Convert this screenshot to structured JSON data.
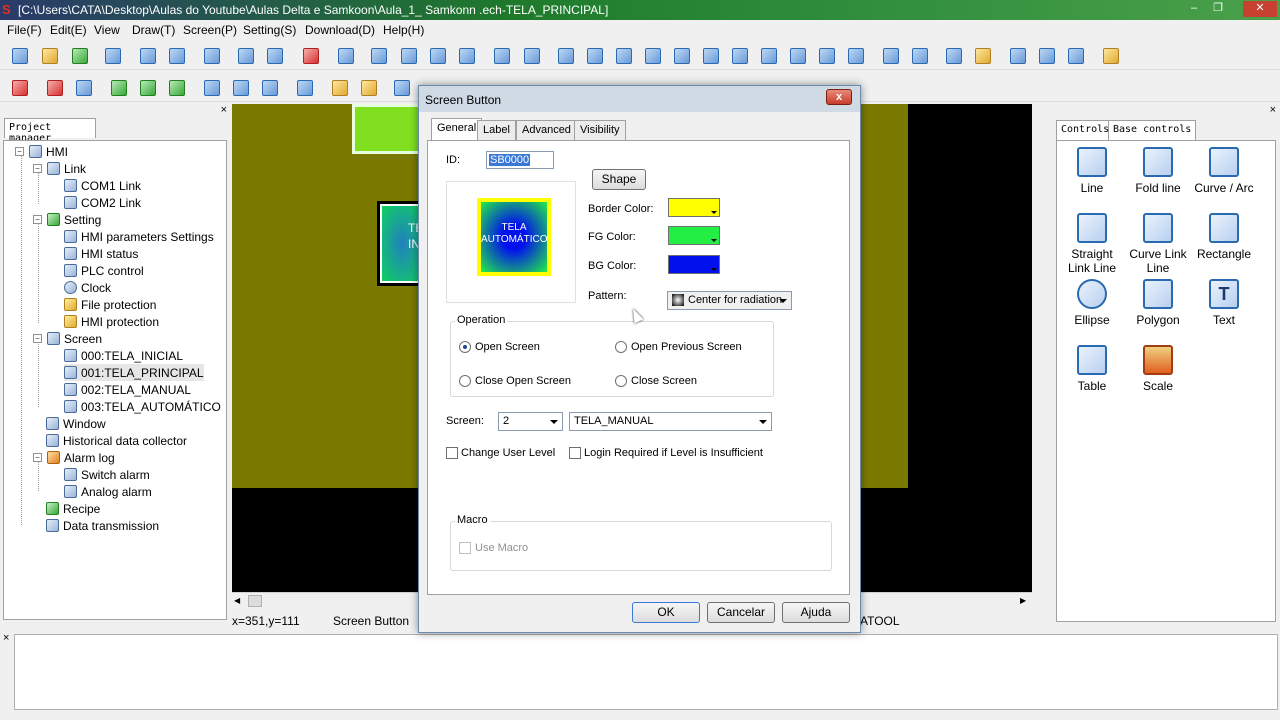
{
  "window": {
    "title": "[C:\\Users\\CATA\\Desktop\\Aulas do Youtube\\Aulas Delta e Samkoon\\Aula_1_ Samkonn .ech-TELA_PRINCIPAL]",
    "min": "–",
    "max": "❐",
    "close": "✕"
  },
  "menu": [
    "File(F)",
    "Edit(E)",
    "View",
    "Draw(T)",
    "Screen(P)",
    "Setting(S)",
    "Download(D)",
    "Help(H)"
  ],
  "project_manager": {
    "tab": "Project manager",
    "close": "×",
    "tree": [
      {
        "label": "HMI",
        "depth": 0
      },
      {
        "label": "Link",
        "depth": 1
      },
      {
        "label": "COM1 Link",
        "depth": 2
      },
      {
        "label": "COM2 Link",
        "depth": 2
      },
      {
        "label": "Setting",
        "depth": 1
      },
      {
        "label": "HMI parameters Settings",
        "depth": 2
      },
      {
        "label": "HMI status",
        "depth": 2
      },
      {
        "label": "PLC control",
        "depth": 2
      },
      {
        "label": "Clock",
        "depth": 2
      },
      {
        "label": "File protection",
        "depth": 2
      },
      {
        "label": "HMI protection",
        "depth": 2
      },
      {
        "label": "Screen",
        "depth": 1
      },
      {
        "label": "000:TELA_INICIAL",
        "depth": 2
      },
      {
        "label": "001:TELA_PRINCIPAL",
        "depth": 2
      },
      {
        "label": "002:TELA_MANUAL",
        "depth": 2
      },
      {
        "label": "003:TELA_AUTOMÁTICO",
        "depth": 2
      },
      {
        "label": "Window",
        "depth": 1
      },
      {
        "label": "Historical data collector",
        "depth": 1
      },
      {
        "label": "Alarm log",
        "depth": 1
      },
      {
        "label": "Switch alarm",
        "depth": 2
      },
      {
        "label": "Analog alarm",
        "depth": 2
      },
      {
        "label": "Recipe",
        "depth": 1
      },
      {
        "label": "Data transmission",
        "depth": 1
      }
    ]
  },
  "canvas": {
    "partial_button_text": "TE\nIN"
  },
  "status": {
    "coords": "x=351,y=111",
    "object": "Screen Button",
    "right": "ATOOL"
  },
  "controls_panel": {
    "tabs": [
      "Controls",
      "Base controls"
    ],
    "close": "×",
    "items": [
      "Line",
      "Fold line",
      "Curve / Arc",
      "Straight Link Line",
      "Curve Link Line",
      "Rectangle",
      "Ellipse",
      "Polygon",
      "Text",
      "Table",
      "Scale"
    ]
  },
  "dialog": {
    "title": "Screen Button",
    "close": "x",
    "tabs": [
      "General",
      "Label",
      "Advanced",
      "Visibility"
    ],
    "id_label": "ID:",
    "id_value": "SB0000",
    "shape_button": "Shape",
    "preview_text": "TELA\nAUTOMÁTICO",
    "border_color_label": "Border Color:",
    "fg_color_label": "FG Color:",
    "bg_color_label": "BG Color:",
    "pattern_label": "Pattern:",
    "pattern_value": "Center for radiation",
    "colors": {
      "border": "#ffff00",
      "fg": "#22ee44",
      "bg": "#0011ee"
    },
    "operation_label": "Operation",
    "op_open_screen": "Open Screen",
    "op_open_previous": "Open Previous Screen",
    "op_close_open": "Close Open Screen",
    "op_close_screen": "Close Screen",
    "screen_label": "Screen:",
    "screen_number": "2",
    "screen_name": "TELA_MANUAL",
    "change_user_level": "Change User Level",
    "login_required": "Login Required if  Level is Insufficient",
    "macro_label": "Macro",
    "use_macro": "Use Macro",
    "ok": "OK",
    "cancel": "Cancelar",
    "help": "Ajuda"
  },
  "output_close": "×"
}
